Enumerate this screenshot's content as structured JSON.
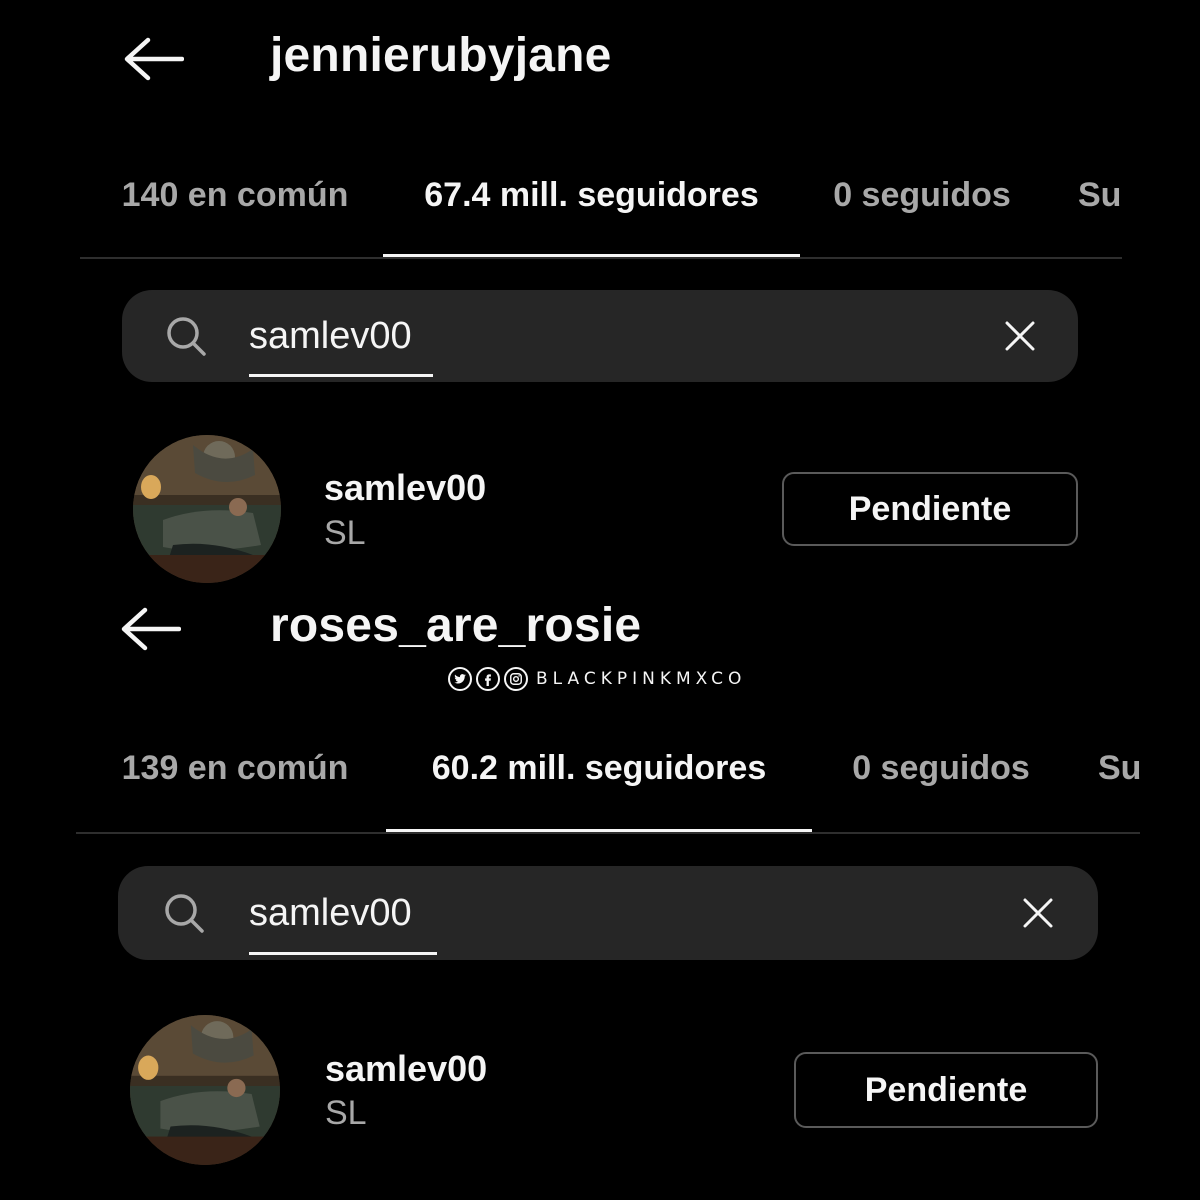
{
  "panels": [
    {
      "title": "jennierubyjane",
      "tabs": [
        "140 en común",
        "67.4 mill. seguidores",
        "0 seguidos",
        "Su"
      ],
      "active_tab": 1,
      "search": {
        "value": "samlev00"
      },
      "result": {
        "username": "samlev00",
        "fullname": "SL",
        "button_label": "Pendiente"
      }
    },
    {
      "title": "roses_are_rosie",
      "tabs": [
        "139 en común",
        "60.2 mill. seguidores",
        "0 seguidos",
        "Su"
      ],
      "active_tab": 1,
      "search": {
        "value": "samlev00"
      },
      "result": {
        "username": "samlev00",
        "fullname": "SL",
        "button_label": "Pendiente"
      }
    }
  ],
  "watermark": {
    "text": "BLACKPINKMXCO",
    "icons": [
      "twitter-icon",
      "facebook-icon",
      "instagram-icon"
    ]
  },
  "colors": {
    "background": "#000000",
    "text": "#f5f5f5",
    "muted": "#a8a8a8",
    "search_bg": "#262626"
  }
}
